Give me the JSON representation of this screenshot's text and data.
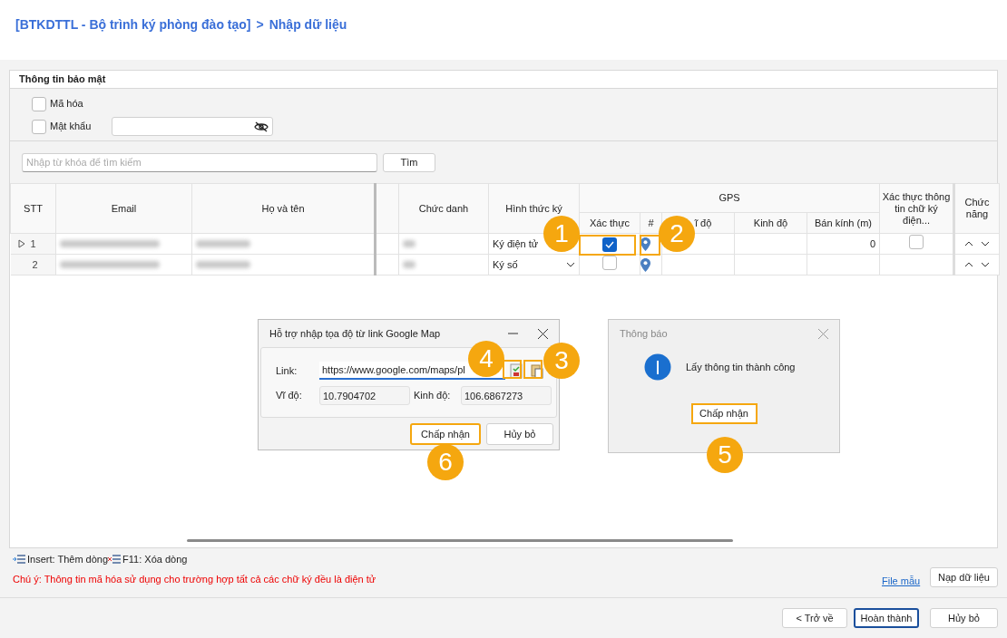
{
  "breadcrumb": {
    "parent": "[BTKDTTL - Bộ trình ký phòng đào tạo]",
    "separator": ">",
    "current": "Nhập dữ liệu"
  },
  "security": {
    "title": "Thông tin bảo mật",
    "options": [
      {
        "label": "Mã hóa",
        "checked": false
      },
      {
        "label": "Mật khẩu",
        "checked": false
      }
    ]
  },
  "search": {
    "placeholder": "Nhập từ khóa để tìm kiếm",
    "button": "Tìm"
  },
  "table": {
    "columns": {
      "stt": "STT",
      "email": "Email",
      "name": "Họ và tên",
      "title": "Chức danh",
      "method": "Hình thức ký",
      "gps": "GPS",
      "gps_verify": "Xác thực",
      "gps_pin": "#",
      "lat": "ĩ độ",
      "lng": "Kinh độ",
      "radius": "Bán kính (m)",
      "esign": "Xác thực thông tin chữ ký điện...",
      "actions": "Chức năng"
    },
    "rows": [
      {
        "stt": "1",
        "selected": true,
        "method": "Ký điện tử",
        "method_caret": false,
        "gps_verified": true,
        "radius": "0",
        "esign_verified": false
      },
      {
        "stt": "2",
        "selected": false,
        "method": "Ký số",
        "method_caret": true,
        "gps_verified": false
      }
    ]
  },
  "map_dialog": {
    "title": "Hỗ trợ nhập tọa độ từ link Google Map",
    "link_label": "Link:",
    "link_value": "https://www.google.com/maps/pl",
    "lat_label": "Vĩ độ:",
    "lat_value": "10.7904702",
    "lng_label": "Kinh độ:",
    "lng_value": "106.6867273",
    "buttons": [
      "Chấp nhận",
      "Hủy bỏ"
    ]
  },
  "message_dialog": {
    "title": "Thông báo",
    "message": "Lấy thông tin thành công",
    "button": "Chấp nhận"
  },
  "callouts": [
    "1",
    "2",
    "3",
    "4",
    "5",
    "6"
  ],
  "shortcuts": [
    {
      "kind": "insert",
      "label": "Insert: Thêm dòng"
    },
    {
      "kind": "delete",
      "label": "F11: Xóa dòng"
    }
  ],
  "note": "Chú ý: Thông tin mã hóa sử dụng cho trường hợp tất cả các chữ ký đều là điện tử",
  "template_link": "File mẫu",
  "load_button": "Nạp dữ liệu",
  "footer_buttons": [
    {
      "label": "< Trở về",
      "primary": false
    },
    {
      "label": "Hoàn thành",
      "primary": true
    },
    {
      "label": "Hủy bỏ",
      "primary": false
    }
  ]
}
